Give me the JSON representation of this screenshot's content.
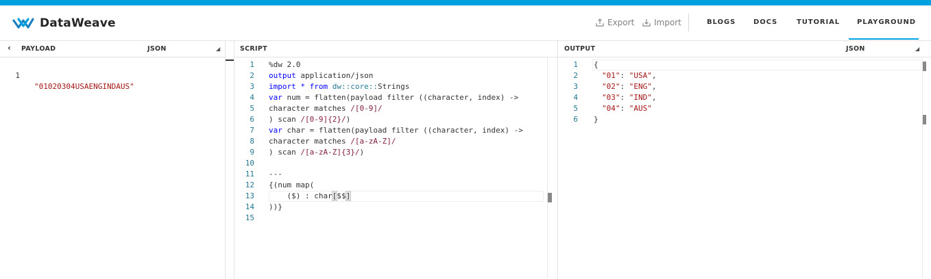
{
  "brand": {
    "name": "DataWeave"
  },
  "header": {
    "export_label": "Export",
    "import_label": "Import",
    "nav": {
      "blogs": "BLOGS",
      "docs": "DOCS",
      "tutorial": "TUTORIAL",
      "playground": "PLAYGROUND"
    }
  },
  "colors": {
    "accent": "#00a1df"
  },
  "payload": {
    "title": "PAYLOAD",
    "format": "JSON",
    "lines": [
      {
        "n": "1",
        "text": "\"01020304USAENGINDAUS\""
      }
    ]
  },
  "script": {
    "title": "SCRIPT",
    "line_numbers": [
      "1",
      "2",
      "3",
      "4",
      "5",
      "6",
      "7",
      "8",
      "9",
      "10",
      "11",
      "12",
      "13",
      "14",
      "15"
    ],
    "code": {
      "l1": "%dw 2.0",
      "l2a": "output",
      "l2b": " application/json",
      "l3a": "import",
      "l3b": " * ",
      "l3c": "from",
      "l3d": " ",
      "l3e": "dw::core::",
      "l3f": "Strings",
      "l4a": "var",
      "l4b": " num = flatten(payload filter ((character, index) ->",
      "l5a": "character matches ",
      "l5b": "/[0-9]/",
      "l6a": ") scan ",
      "l6b": "/[0-9]{2}/",
      "l6c": ")",
      "l7a": "var",
      "l7b": " char = flatten(payload filter ((character, index) ->",
      "l8a": "character matches ",
      "l8b": "/[a-zA-Z]/",
      "l9a": ") scan ",
      "l9b": "/[a-zA-Z]{3}/",
      "l9c": ")",
      "l10": "",
      "l11": "---",
      "l12": "{(num map(",
      "l13a": "    ($) : char",
      "l13b": "[",
      "l13c": "$$",
      "l13d": "]",
      "l14": "))}",
      "l15": ""
    }
  },
  "output": {
    "title": "OUTPUT",
    "format": "JSON",
    "line_numbers": [
      "1",
      "2",
      "3",
      "4",
      "5",
      "6"
    ],
    "open_brace": "{",
    "close_brace": "}",
    "entries": [
      {
        "key": "\"01\"",
        "value": "\"USA\"",
        "trail": ","
      },
      {
        "key": "\"02\"",
        "value": "\"ENG\"",
        "trail": ","
      },
      {
        "key": "\"03\"",
        "value": "\"IND\"",
        "trail": ","
      },
      {
        "key": "\"04\"",
        "value": "\"AUS\"",
        "trail": ""
      }
    ],
    "colon": ": "
  }
}
